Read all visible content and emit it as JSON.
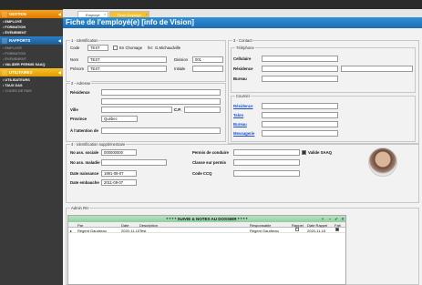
{
  "sidebar": {
    "gestion": {
      "label": "GESTION",
      "items": [
        "EMPLOYÉ",
        "FORMATION",
        "ÉVÉNEMENT"
      ]
    },
    "rapports": {
      "label": "RAPPORTS",
      "items": [
        "EMPLOYÉ",
        "FORMATION",
        "ÉVÉNEMENT",
        "VALIDER PERMIS SAAQ"
      ]
    },
    "utilitaires": {
      "label": "UTILITAIRES",
      "items": [
        "UTILISATEURS",
        "TAUX DAS",
        "CODES DE PAIE"
      ]
    }
  },
  "tabs": [
    "Employé",
    "Fiche Employé"
  ],
  "page_title": "Fiche de l'employé(e) [info de Vision]",
  "identification": {
    "legend": "1 - Identification",
    "code_label": "Code",
    "code_value": "TEST",
    "chomage_label": "En Chomage",
    "fer_label": "fer:",
    "fer_value": "G.Michaudville",
    "nom_label": "Nom",
    "nom_value": "TEST",
    "division_label": "Division",
    "division_value": "001",
    "prenom_label": "Prénom",
    "prenom_value": "TEST",
    "initiale_label": "Initiale",
    "initiale_value": ""
  },
  "adresse": {
    "legend": "2 - Adresse",
    "residence_label": "Résidence",
    "ville_label": "Ville",
    "cp_label": "C.P.",
    "province_label": "Province",
    "province_value": "Québec",
    "attention_label": "À l'attention de"
  },
  "contact": {
    "legend": "3 - Contact",
    "telephone_label": "Téléphone",
    "cellulaire_label": "Cellulaire",
    "residence_label": "Résidence",
    "bureau_label": "Bureau",
    "courriel_label": "Courriel",
    "courriel_residence": "Résidence",
    "courriel_talon": "Talon",
    "courriel_bureau": "Bureau",
    "courriel_messagerie": "Messagerie"
  },
  "supplementaire": {
    "legend": "4 - Identification supplémentaire",
    "nas_label": "No ass. sociale",
    "nas_value": "000000000",
    "nam_label": "No ass. maladie",
    "nam_value": "",
    "naissance_label": "Date naissance",
    "naissance_value": "1991-09-07",
    "embauche_label": "Date embauche",
    "embauche_value": "2011-09-07",
    "permis_label": "Permis de conduire",
    "permis_value": "",
    "valide_label": "Valide SAAQ",
    "classe_label": "Classe sur permis",
    "classe_value": "",
    "ccq_label": "Code CCQ",
    "ccq_value": ""
  },
  "admin": {
    "legend": "Admin RH",
    "grid_title": "* * * *  SUIVIE & NOTES AU DOSSIER  * * * *",
    "columns": [
      "Par",
      "Date",
      "Description",
      "Responsable",
      "Rappel",
      "Date Rappel",
      "Fait"
    ],
    "rows": [
      {
        "par": "Régent Gaudreau",
        "date": "2020-11-10",
        "description": "Test",
        "responsable": "Régent Gaudreau",
        "rappel": false,
        "date_rappel": "2020-11-15",
        "fait": true
      }
    ]
  },
  "colors": {
    "title_blue": "#1f6bb0",
    "orange": "#f7a31c",
    "grid_head": "#8fcfa0"
  }
}
